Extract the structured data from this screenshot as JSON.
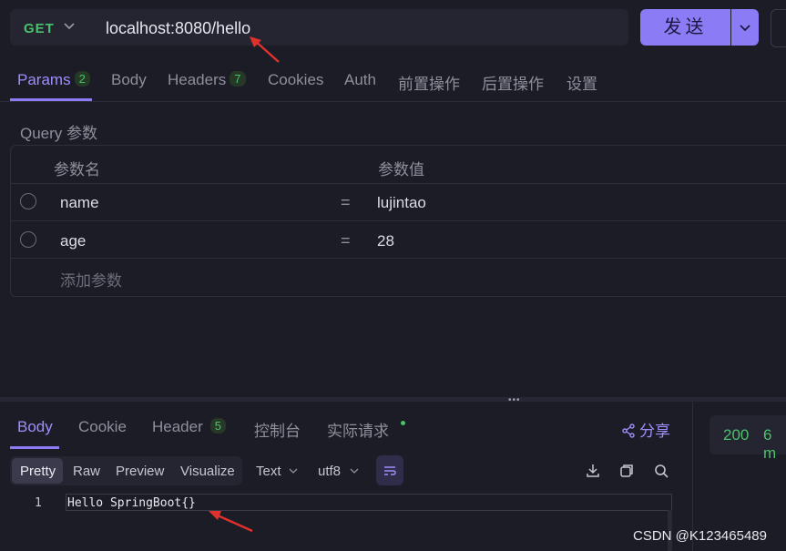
{
  "request": {
    "method": "GET",
    "url": "localhost:8080/hello",
    "send_label": "发送"
  },
  "tabs": [
    {
      "label": "Params",
      "badge": "2",
      "active": true
    },
    {
      "label": "Body"
    },
    {
      "label": "Headers",
      "badge": "7"
    },
    {
      "label": "Cookies"
    },
    {
      "label": "Auth"
    },
    {
      "label": "前置操作"
    },
    {
      "label": "后置操作"
    },
    {
      "label": "设置"
    }
  ],
  "params": {
    "section_label": "Query 参数",
    "col_name": "参数名",
    "col_value": "参数值",
    "rows": [
      {
        "name": "name",
        "op": "=",
        "value": "lujintao"
      },
      {
        "name": "age",
        "op": "=",
        "value": "28"
      }
    ],
    "add_placeholder": "添加参数"
  },
  "response": {
    "tabs": [
      {
        "label": "Body",
        "active": true
      },
      {
        "label": "Cookie"
      },
      {
        "label": "Header",
        "badge": "5"
      },
      {
        "label": "控制台"
      },
      {
        "label": "实际请求"
      }
    ],
    "share_label": "分享",
    "status": "200",
    "time": "6 m",
    "view_modes": [
      "Pretty",
      "Raw",
      "Preview",
      "Visualize"
    ],
    "active_view": "Pretty",
    "format": "Text",
    "encoding": "utf8",
    "lines": [
      {
        "no": "1",
        "text": "Hello SpringBoot{}"
      }
    ]
  },
  "watermark": "CSDN @K123465489",
  "colors": {
    "accent": "#8b7cf6",
    "success": "#49c26b",
    "background": "#1c1c27",
    "annotation_arrow": "#e0312b"
  }
}
